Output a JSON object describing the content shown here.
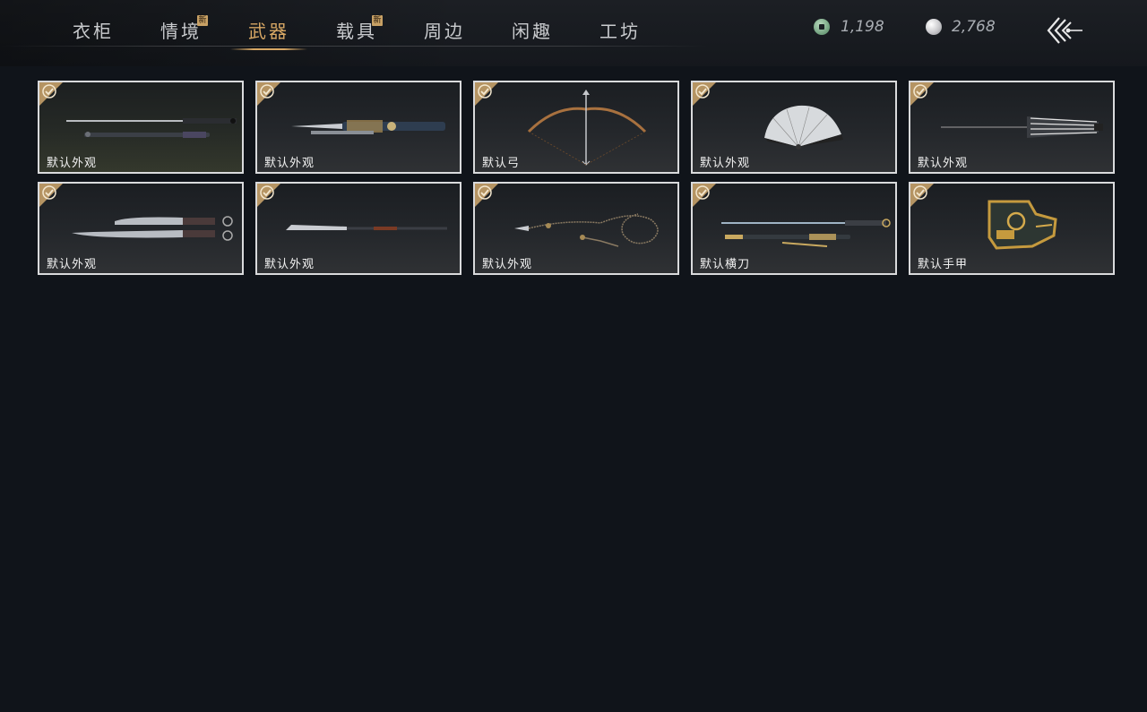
{
  "tabs": [
    {
      "label": "衣柜",
      "badge": ""
    },
    {
      "label": "情境",
      "badge": "新"
    },
    {
      "label": "武器",
      "badge": "",
      "active": true
    },
    {
      "label": "载具",
      "badge": "新"
    },
    {
      "label": "周边",
      "badge": ""
    },
    {
      "label": "闲趣",
      "badge": ""
    },
    {
      "label": "工坊",
      "badge": ""
    }
  ],
  "currency": {
    "jade": {
      "icon": "jade-coin-icon",
      "value": "1,198"
    },
    "pearl": {
      "icon": "pearl-icon",
      "value": "2,768"
    }
  },
  "back": {
    "icon": "back-arrow-icon"
  },
  "items": [
    {
      "label": "默认外观",
      "icon": "sword-icon",
      "owned": true
    },
    {
      "label": "默认外观",
      "icon": "ornate-sword-icon",
      "owned": true
    },
    {
      "label": "默认弓",
      "icon": "bow-icon",
      "owned": true
    },
    {
      "label": "默认外观",
      "icon": "fan-icon",
      "owned": true
    },
    {
      "label": "默认外观",
      "icon": "umbrella-icon",
      "owned": true
    },
    {
      "label": "默认外观",
      "icon": "dual-blades-icon",
      "owned": true
    },
    {
      "label": "默认外观",
      "icon": "spear-icon",
      "owned": true
    },
    {
      "label": "默认外观",
      "icon": "rope-dart-icon",
      "owned": true
    },
    {
      "label": "默认横刀",
      "icon": "hengdao-icon",
      "owned": true
    },
    {
      "label": "默认手甲",
      "icon": "gauntlet-icon",
      "owned": true
    }
  ],
  "colors": {
    "accent": "#d7a764",
    "check": "#b59463",
    "background": "#10141a"
  }
}
